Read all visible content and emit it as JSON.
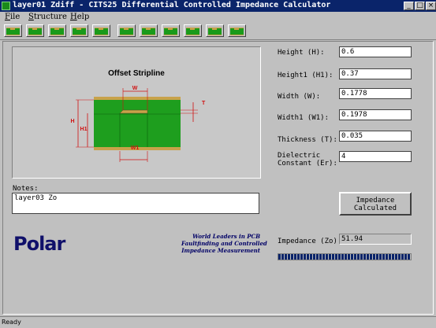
{
  "window": {
    "title": "layer01 Zdiff - CITS25 Differential Controlled Impedance Calculator",
    "controls": {
      "minimize": "_",
      "maximize": "□",
      "close": "×"
    }
  },
  "menu": [
    {
      "key": "F",
      "label": "File"
    },
    {
      "key": "S",
      "label": "Structure"
    },
    {
      "key": "H",
      "label": "Help"
    }
  ],
  "toolbar": {
    "button_count": 11,
    "icon": "stripline-structure-icon"
  },
  "diagram": {
    "title": "Offset Stripline",
    "labels": {
      "w": "W",
      "w1": "W1",
      "h": "H",
      "h1": "H1",
      "t": "T"
    },
    "colors": {
      "dielectric": "#1e9e1e",
      "copper": "#c8a24a",
      "dimension": "#d01010"
    }
  },
  "params": [
    {
      "label": "Height (H):",
      "value": "0.6"
    },
    {
      "label": "Height1 (H1):",
      "value": "0.37"
    },
    {
      "label": "Width (W):",
      "value": "0.1778"
    },
    {
      "label": "Width1 (W1):",
      "value": "0.1978"
    },
    {
      "label": "Thickness (T):",
      "value": "0.035"
    },
    {
      "label": "Dielectric\nConstant (Er):",
      "label_line1": "Dielectric",
      "label_line2": "Constant (Er):",
      "value": "4"
    }
  ],
  "notes": {
    "label": "Notes:",
    "value": "layer03 Zo"
  },
  "calculate": {
    "line1": "Impedance",
    "line2": "Calculated"
  },
  "result": {
    "label": "Impedance (Zo):",
    "value": "51.94"
  },
  "brand": {
    "logo": "Polar",
    "slogan_line1": "World Leaders in PCB",
    "slogan_line2": "Faultfinding and Controlled",
    "slogan_line3": "Impedance Measurement",
    "color": "#10106a"
  },
  "status": "Ready",
  "progress": 1.0
}
